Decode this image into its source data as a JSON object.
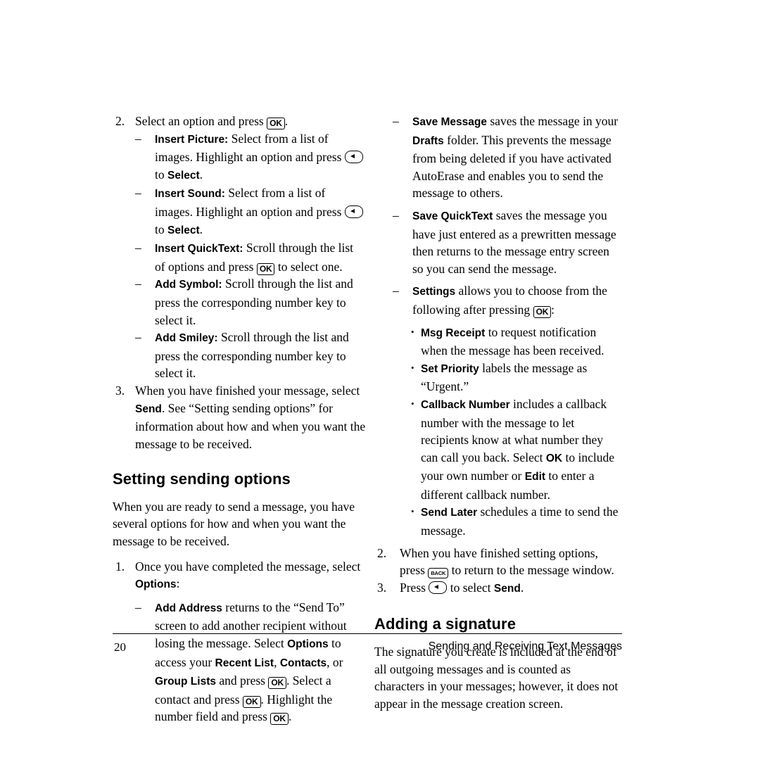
{
  "document": {
    "footer": {
      "page_number": "20",
      "section_title": "Sending and Receiving Text Messages"
    }
  },
  "left_column": {
    "step2": {
      "marker": "2.",
      "text_before": "Select an option and press",
      "key": "OK",
      "text_after": "."
    },
    "sub_items": [
      {
        "marker": "–",
        "bold": "Insert Picture:",
        "text": " Select from a list of images. Highlight an option and press",
        "key": "soft-key",
        "text_mid": " to ",
        "bold_end": "Select",
        "text_end": "."
      },
      {
        "marker": "–",
        "bold": "Insert Sound:",
        "text": " Select from a list of images. Highlight an option and press",
        "key": "soft-key",
        "text_mid": " to ",
        "bold_end": "Select",
        "text_end": "."
      },
      {
        "marker": "–",
        "bold": "Insert QuickText:",
        "text": " Scroll through the list of options and press",
        "key": "OK",
        "text_end": " to select one."
      },
      {
        "marker": "–",
        "bold": "Add Symbol:",
        "text": " Scroll through the list and press the corresponding number key to select it."
      },
      {
        "marker": "–",
        "bold": "Add Smiley:",
        "text": " Scroll through the list and press the corresponding number key to select it."
      }
    ],
    "step3": {
      "marker": "3.",
      "text_a": "When you have finished your message, select ",
      "bold_a": "Send",
      "text_b": ". See “Setting sending options” for information about how and when you want the message to be received."
    },
    "heading_setting_sending_options": "Setting sending options",
    "intro_paragraph": "When you are ready to send a message, you have several options for how and when you want the message to be received.",
    "step1": {
      "marker": "1.",
      "text_a": "Once you have completed the message, select ",
      "bold_a": "Options",
      "text_b": ":"
    },
    "add_address": {
      "marker": "–",
      "bold": "Add Address",
      "text_a": " returns to the “Send To” screen to add another recipient without losing the message. Select ",
      "bold_b": "Options",
      "text_b": " to access your ",
      "bold_c": "Recent List",
      "text_c": ", ",
      "bold_d": "Contacts",
      "text_d": ", or ",
      "bold_e": "Group Lists",
      "text_e": " and press ",
      "key1": "OK",
      "text_f": ". Select a contact and press ",
      "key2": "OK",
      "text_g": ". Highlight the number field and press ",
      "key3": "OK",
      "text_h": "."
    }
  },
  "right_column": {
    "save_message": {
      "marker": "–",
      "bold_a": "Save Message",
      "text_a": " saves the message in your ",
      "bold_b": "Drafts",
      "text_b": " folder. This prevents the message from being deleted if you have activated AutoErase and enables you to send the message to others."
    },
    "save_quicktext": {
      "marker": "–",
      "bold_a": "Save QuickText",
      "text_a": " saves the message you have just entered as a prewritten message then returns to the message entry screen so you can send the message."
    },
    "settings": {
      "marker": "–",
      "bold_a": "Settings",
      "text_a": " allows you to choose from the following after pressing ",
      "key": "OK",
      "text_b": ":"
    },
    "bullets": [
      {
        "marker": "•",
        "bold": "Msg Receipt",
        "text": " to request notification when the message has been received."
      },
      {
        "marker": "•",
        "bold": "Set Priority",
        "text": " labels the message as “Urgent.”"
      },
      {
        "marker": "•",
        "bold": "Callback Number",
        "text_a": " includes a callback number with the message to let recipients know at what number they can call you back. Select ",
        "bold_b": "OK",
        "text_b": " to include your own number or ",
        "bold_c": "Edit",
        "text_c": " to enter a different callback number."
      },
      {
        "marker": "•",
        "bold": "Send Later",
        "text": " schedules a time to send the message."
      }
    ],
    "step2": {
      "marker": "2.",
      "text_a": "When you have finished setting options, press ",
      "key": "BACK",
      "text_b": " to return to the message window."
    },
    "step3": {
      "marker": "3.",
      "text_a": "Press ",
      "key": "soft-key",
      "text_b": " to select ",
      "bold_b": "Send",
      "text_c": "."
    },
    "heading_adding_a_signature": "Adding a signature",
    "signature_paragraph": "The signature you create is included at the end of all outgoing messages and is counted as characters in your messages; however, it does not appear in the message creation screen."
  }
}
